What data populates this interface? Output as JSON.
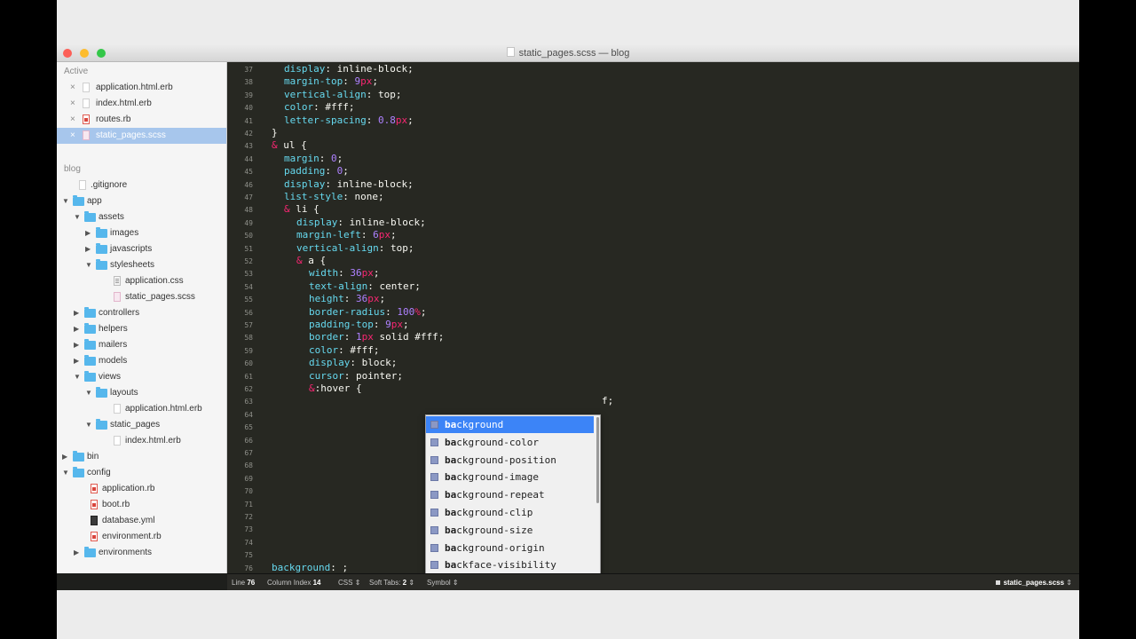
{
  "window": {
    "title": "static_pages.scss — blog"
  },
  "sidebar": {
    "open_files_header": "Active",
    "open_files": [
      {
        "name": "application.html.erb",
        "icon": "erb-file-icon",
        "close": "×"
      },
      {
        "name": "index.html.erb",
        "icon": "erb-file-icon",
        "close": "×"
      },
      {
        "name": "routes.rb",
        "icon": "ruby-file-icon",
        "close": "×"
      },
      {
        "name": "static_pages.scss",
        "icon": "scss-file-icon",
        "close": "×",
        "selected": true
      }
    ],
    "project_header": "blog",
    "tree": [
      {
        "name": ".gitignore",
        "kind": "file"
      },
      {
        "name": "app",
        "kind": "folder",
        "open": true
      },
      {
        "name": "assets",
        "kind": "folder",
        "open": true
      },
      {
        "name": "images",
        "kind": "folder",
        "open": false
      },
      {
        "name": "javascripts",
        "kind": "folder",
        "open": false
      },
      {
        "name": "stylesheets",
        "kind": "folder",
        "open": true
      },
      {
        "name": "application.css",
        "kind": "css"
      },
      {
        "name": "static_pages.scss",
        "kind": "scss"
      },
      {
        "name": "controllers",
        "kind": "folder",
        "open": false
      },
      {
        "name": "helpers",
        "kind": "folder",
        "open": false
      },
      {
        "name": "mailers",
        "kind": "folder",
        "open": false
      },
      {
        "name": "models",
        "kind": "folder",
        "open": false
      },
      {
        "name": "views",
        "kind": "folder",
        "open": true
      },
      {
        "name": "layouts",
        "kind": "folder",
        "open": true
      },
      {
        "name": "application.html.erb",
        "kind": "file"
      },
      {
        "name": "static_pages",
        "kind": "folder",
        "open": true
      },
      {
        "name": "index.html.erb",
        "kind": "file"
      },
      {
        "name": "bin",
        "kind": "folder",
        "open": false
      },
      {
        "name": "config",
        "kind": "folder",
        "open": true
      },
      {
        "name": "application.rb",
        "kind": "rb"
      },
      {
        "name": "boot.rb",
        "kind": "rb"
      },
      {
        "name": "database.yml",
        "kind": "yml"
      },
      {
        "name": "environment.rb",
        "kind": "rb"
      },
      {
        "name": "environments",
        "kind": "folder",
        "open": false
      }
    ],
    "project_selector": "blog"
  },
  "editor": {
    "line_numbers": [
      "37",
      "38",
      "39",
      "40",
      "41",
      "42",
      "43",
      "44",
      "45",
      "46",
      "47",
      "48",
      "49",
      "50",
      "51",
      "52",
      "53",
      "54",
      "55",
      "56",
      "57",
      "58",
      "59",
      "60",
      "61",
      "62",
      "63",
      "64",
      "65",
      "66",
      "67",
      "68",
      "69",
      "70",
      "71",
      "72",
      "73",
      "74",
      "75",
      "76"
    ],
    "visible_code": [
      "  display: inline-block;",
      "  margin-top: 9px;",
      "  vertical-align: top;",
      "  color: #fff;",
      "  letter-spacing: 0.8px;",
      "}",
      "& ul {",
      "  margin: 0;",
      "  padding: 0;",
      "  display: inline-block;",
      "  list-style: none;",
      "  & li {",
      "    display: inline-block;",
      "    margin-left: 6px;",
      "    vertical-align: top;",
      "    & a {",
      "      width: 36px;",
      "      text-align: center;",
      "      height: 36px;",
      "      border-radius: 100%;",
      "      padding-top: 9px;",
      "      border: 1px solid #fff;",
      "      color: #fff;",
      "      display: block;",
      "      cursor: pointer;",
      "      &:hover {"
    ],
    "line63_tail": "f;",
    "current_line": "background: ;"
  },
  "autocomplete": {
    "typed": "ba",
    "items": [
      {
        "bold": "ba",
        "rest": "ckground"
      },
      {
        "bold": "ba",
        "rest": "ckground-color"
      },
      {
        "bold": "ba",
        "rest": "ckground-position"
      },
      {
        "bold": "ba",
        "rest": "ckground-image"
      },
      {
        "bold": "ba",
        "rest": "ckground-repeat"
      },
      {
        "bold": "ba",
        "rest": "ckground-clip"
      },
      {
        "bold": "ba",
        "rest": "ckground-size"
      },
      {
        "bold": "ba",
        "rest": "ckground-origin"
      },
      {
        "bold": "ba",
        "rest": "ckface-visibility"
      }
    ],
    "selected_index": 0,
    "icon": "property-icon"
  },
  "status_bar": {
    "line_label": "Line",
    "line_value": "76",
    "col_label": "Column Index",
    "col_value": "14",
    "syntax": "CSS",
    "tabs_label": "Soft Tabs:",
    "tabs_value": "2",
    "symbol": "Symbol",
    "file": "static_pages.scss",
    "updown": "⇕"
  },
  "colors": {
    "editor_bg": "#272822",
    "sidebar_bg": "#f5f5f5",
    "selection": "#3c84f7",
    "keyword": "#66d9ef",
    "number": "#ae81ff",
    "unit": "#f92672"
  }
}
